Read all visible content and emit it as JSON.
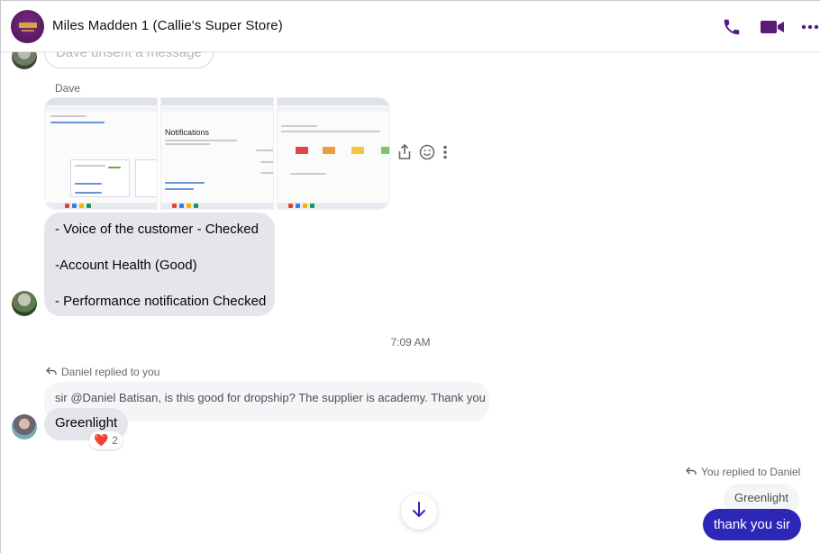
{
  "header": {
    "title": "Miles Madden 1 (Callie's Super Store)",
    "accent_color": "#5b1a7a",
    "icons": [
      "phone-icon",
      "video-icon",
      "more-icon"
    ]
  },
  "messages": {
    "unsent_text": "Dave unsent a message",
    "sender_name": "Dave",
    "thumbnail_caption": "Notifications",
    "list_lines": [
      "- Voice of the customer - Checked",
      "-Account Health (Good)",
      "- Performance notification Checked"
    ],
    "timestamp": "7:09 AM",
    "reply_note_left": "Daniel replied to you",
    "quoted_text": "sir @Daniel Batisan, is this good for dropship? The supplier is academy. Thank you",
    "reply_text": "Greenlight",
    "reaction_emoji": "❤️",
    "reaction_count": "2",
    "reply_note_right": "You replied to Daniel",
    "quoted_text_right": "Greenlight",
    "my_message": "thank you sir",
    "my_bubble_color": "#2d27b8"
  }
}
